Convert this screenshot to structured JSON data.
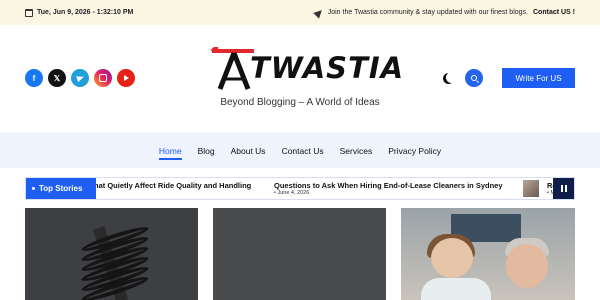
{
  "topbar": {
    "date": "Tue, Jun 9, 2026 - 1:32:10 PM",
    "notice": "Join the Twastia community & stay updated with our finest blogs.",
    "contact_label": "Contact US !"
  },
  "header": {
    "socials": [
      "facebook-icon",
      "x-icon",
      "telegram-icon",
      "instagram-icon",
      "youtube-icon"
    ],
    "logo_text": "TWASTIA",
    "tagline": "Beyond Blogging – A World of Ideas",
    "write_button": "Write For US",
    "brand_color": "#1e5ef3",
    "logo_accent_color": "#e0282e"
  },
  "nav": {
    "items": [
      {
        "label": "Home",
        "active": true
      },
      {
        "label": "Blog",
        "active": false
      },
      {
        "label": "About Us",
        "active": false
      },
      {
        "label": "Contact Us",
        "active": false
      },
      {
        "label": "Services",
        "active": false
      },
      {
        "label": "Privacy Policy",
        "active": false
      }
    ]
  },
  "ticker": {
    "label": "Top Stories",
    "items": [
      {
        "title": "hat Quietly Affect Ride Quality and Handling",
        "date": ""
      },
      {
        "title": "Questions to Ask When Hiring End-of-Lease Cleaners in Sydney",
        "date": "June 4, 2026"
      },
      {
        "title": "Re",
        "date": "M"
      }
    ]
  },
  "cards": [
    {
      "image": "suspension-coil-spring"
    },
    {
      "image": "dark-placeholder"
    },
    {
      "image": "hospital-nurse-elderly-patient"
    }
  ]
}
